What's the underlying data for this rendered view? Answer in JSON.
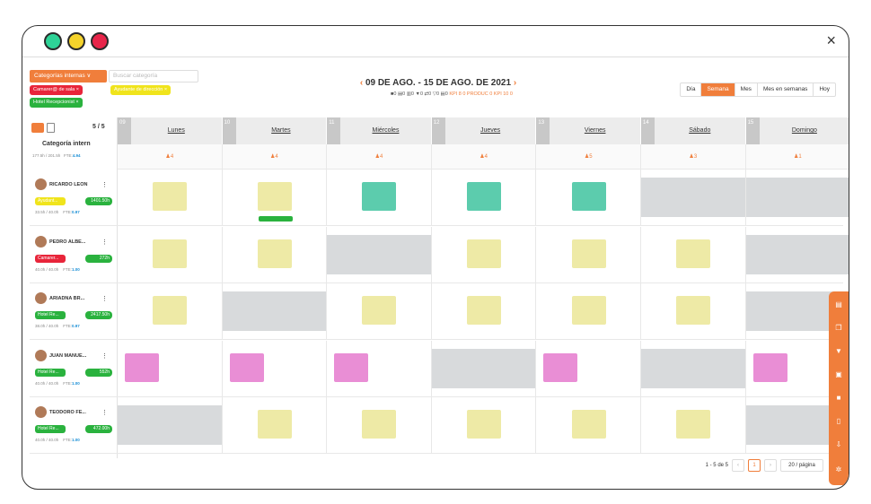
{
  "window": {
    "close_icon": "×"
  },
  "header": {
    "category_dropdown": "Categorías internas ∨",
    "category_search_placeholder": "Buscar categoría",
    "filter_tags": [
      {
        "label": "Camarer@ de sala ×",
        "color": "#e8253a"
      },
      {
        "label": "Ayudante de dirección ×",
        "color": "#f0e41c"
      },
      {
        "label": "Hotel Recepcionist ×",
        "color": "#2ab23e"
      }
    ],
    "date_range": "09 DE AGO. - 15 DE AGO. DE 2021",
    "counters": "■0 ▤0 ▥0 ▼0 ⇄0 ▽0 ▤0",
    "kpi_labels": "KPI 8 0  PRODUC 0  KPI 10 0",
    "view_tabs": [
      "Día",
      "Semana",
      "Mes",
      "Mes en semanas",
      "Hoy"
    ]
  },
  "left_header": {
    "count": "5 / 5",
    "category_label": "Categoría intern",
    "hours": "177.5h / 201.5h",
    "fte_label": "FTE:",
    "fte": "4.94"
  },
  "days": [
    {
      "num": "09",
      "name": "Lunes",
      "staff": "4"
    },
    {
      "num": "10",
      "name": "Martes",
      "staff": "4"
    },
    {
      "num": "11",
      "name": "Miércoles",
      "staff": "4"
    },
    {
      "num": "12",
      "name": "Jueves",
      "staff": "4"
    },
    {
      "num": "13",
      "name": "Viernes",
      "staff": "5"
    },
    {
      "num": "14",
      "name": "Sábado",
      "staff": "3"
    },
    {
      "num": "15",
      "name": "Domingo",
      "staff": "1"
    }
  ],
  "employees": [
    {
      "name": "RICARDO LEON",
      "tag": "Ayudant...",
      "tag_color": "#f0e41c",
      "hours": "1401.50h",
      "stats": "33.5h / 40.0h",
      "fte": "0.97"
    },
    {
      "name": "PEDRO ALBE...",
      "tag": "Camarer...",
      "tag_color": "#e8253a",
      "hours": "272h",
      "stats": "40.0h / 40.0h",
      "fte": "1.00"
    },
    {
      "name": "ARIADNA BR...",
      "tag": "Hotel Re...",
      "tag_color": "#2ab23e",
      "hours": "2417.50h",
      "stats": "38.0h / 40.0h",
      "fte": "0.97"
    },
    {
      "name": "JUAN MANUE...",
      "tag": "Hotel Re...",
      "tag_color": "#2ab23e",
      "hours": "552h",
      "stats": "40.0h / 40.0h",
      "fte": "1.00"
    },
    {
      "name": "TEODORO FE...",
      "tag": "Hotel Re...",
      "tag_color": "#2ab23e",
      "hours": "472.00h",
      "stats": "40.0h / 40.0h",
      "fte": "1.00"
    }
  ],
  "footer": {
    "range": "1 - 5 de 5",
    "page": "1",
    "per_page": "20 / página"
  }
}
